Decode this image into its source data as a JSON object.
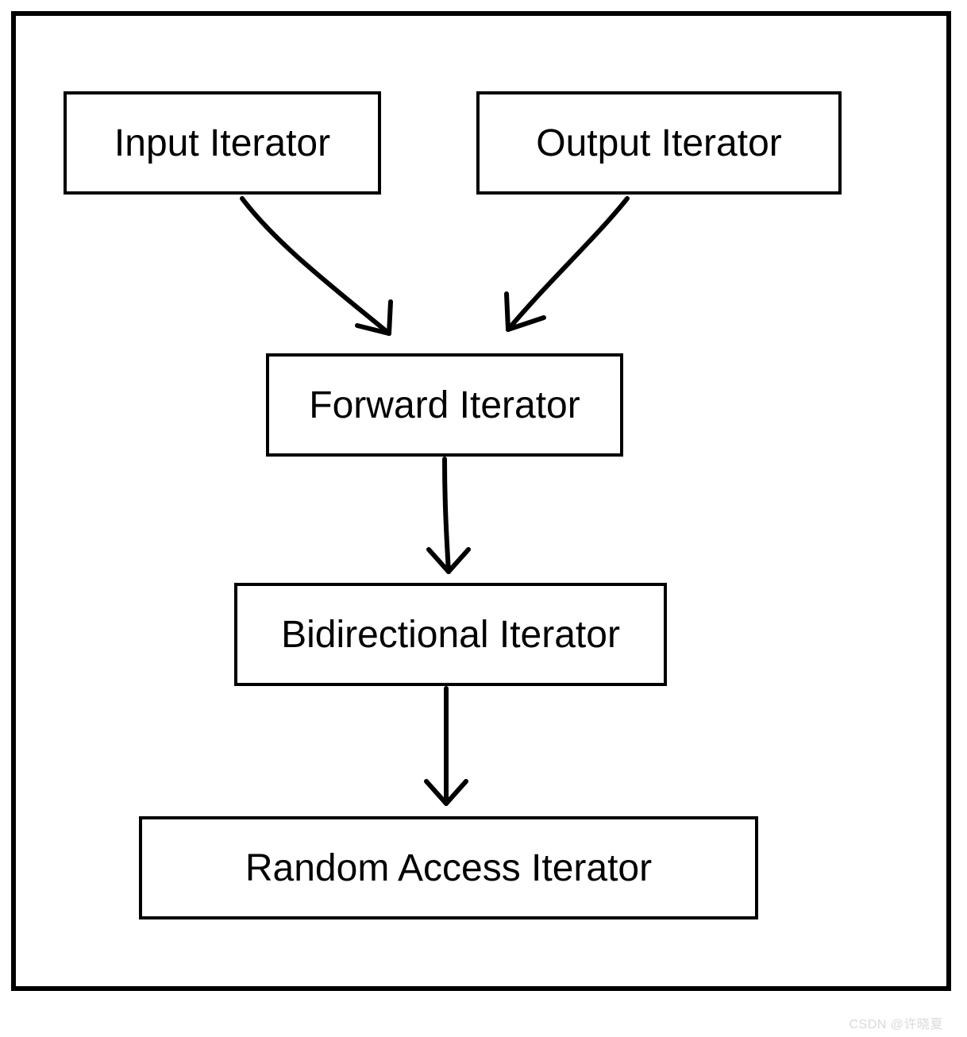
{
  "nodes": {
    "input": {
      "label": "Input Iterator"
    },
    "output": {
      "label": "Output Iterator"
    },
    "forward": {
      "label": "Forward Iterator"
    },
    "bidirectional": {
      "label": "Bidirectional Iterator"
    },
    "random": {
      "label": "Random Access Iterator"
    }
  },
  "edges": [
    {
      "from": "input",
      "to": "forward"
    },
    {
      "from": "output",
      "to": "forward"
    },
    {
      "from": "forward",
      "to": "bidirectional"
    },
    {
      "from": "bidirectional",
      "to": "random"
    }
  ],
  "watermark": "CSDN @许晓夏"
}
